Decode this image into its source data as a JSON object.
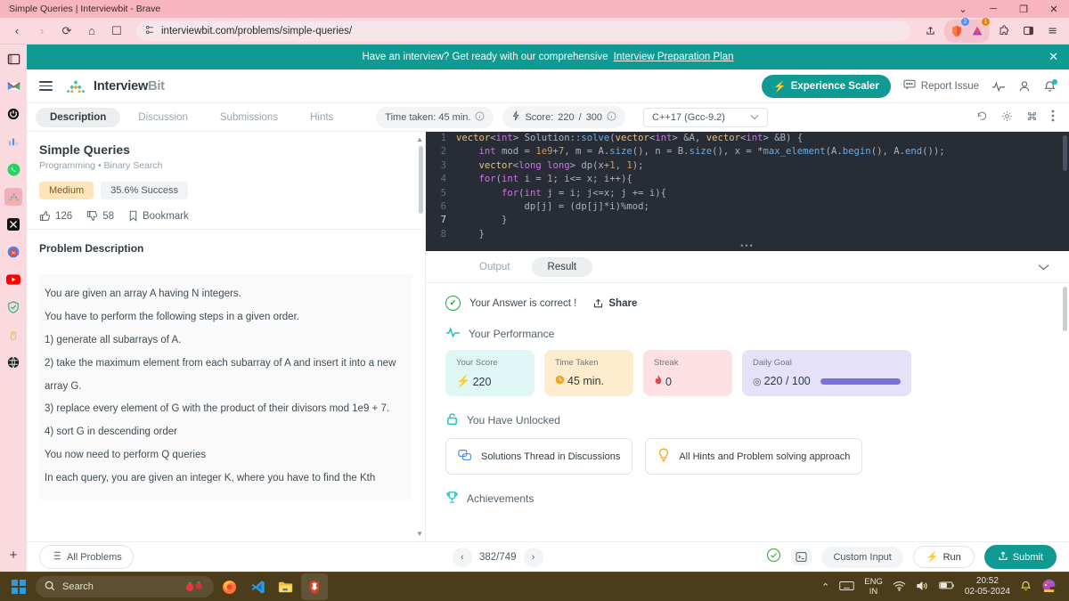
{
  "browser": {
    "tab_title": "Simple Queries | Interviewbit - Brave",
    "url": "interviewbit.com/problems/simple-queries/",
    "window_controls": {
      "minimize": "─",
      "maximize": "❐",
      "close": "✕",
      "tab_search": "⌄"
    },
    "nav": {
      "back": "‹",
      "forward": "›",
      "reload": "⟳",
      "home": "⌂",
      "bookmark": "☐"
    },
    "toolbar_icons": [
      "share-icon",
      "brave-shields-icon",
      "brave-rewards-icon",
      "extensions-icon",
      "sidebar-toggle-icon",
      "menu-icon"
    ],
    "shield_badge": "2",
    "rewards_badge": "1",
    "sidebar_items": [
      "sidebar-panel-icon",
      "gmail-icon",
      "power-icon",
      "chart-icon",
      "whatsapp-icon",
      "interviewbit-icon",
      "x-twitter-icon",
      "calendar-icon",
      "youtube-icon",
      "vpn-icon",
      "hands-icon",
      "globe-icon"
    ],
    "sidebar_add": "+"
  },
  "promo": {
    "text": "Have an interview? Get ready with our comprehensive",
    "link": "Interview Preparation Plan",
    "close": "✕"
  },
  "header": {
    "brand_first": "Interview",
    "brand_second": "Bit",
    "scaler_button": "Experience Scaler",
    "scaler_icon": "⚡",
    "report_issue": "Report Issue",
    "icons": [
      "activity-icon",
      "user-icon",
      "notification-bell-icon"
    ]
  },
  "subbar": {
    "tabs": [
      {
        "label": "Description",
        "active": true
      },
      {
        "label": "Discussion",
        "active": false
      },
      {
        "label": "Submissions",
        "active": false
      },
      {
        "label": "Hints",
        "active": false
      }
    ],
    "time_taken": "Time taken: 45 min.",
    "score": "Score:",
    "score_value": "220",
    "score_sep": "/",
    "score_total": "300",
    "language": "C++17 (Gcc-9.2)",
    "chevron": "⌄",
    "editor_tools": [
      "undo-icon",
      "settings-icon",
      "shortcuts-icon",
      "more-options-icon"
    ]
  },
  "problem": {
    "title": "Simple Queries",
    "subtitle": "Programming • Binary Search",
    "difficulty": "Medium",
    "success_rate": "35.6% Success",
    "likes": "126",
    "dislikes": "58",
    "bookmark": "Bookmark",
    "description_heading": "Problem Description",
    "paragraphs": [
      "You are given an array A having N integers.",
      "You have to perform the following steps in a given order.",
      "1) generate all subarrays of A.",
      "2) take the maximum element from each subarray of A and insert it into a new array G.",
      "3) replace every element of G with the product of their divisors mod 1e9 + 7.",
      "4) sort G in descending order",
      "You now need to perform Q queries",
      "In each query, you are given an integer K, where you have to find the Kth"
    ]
  },
  "editor": {
    "lines": [
      {
        "n": "1",
        "text": "vector<int> Solution::solve(vector<int> &A, vector<int> &B) {"
      },
      {
        "n": "2",
        "text": "    int mod = 1e9+7, m = A.size(), n = B.size(), x = *max_element(A.begin(), A.end());"
      },
      {
        "n": "3",
        "text": "    vector<long long> dp(x+1, 1);"
      },
      {
        "n": "4",
        "text": "    for(int i = 1; i<= x; i++){"
      },
      {
        "n": "5",
        "text": "        for(int j = i; j<=x; j += i){"
      },
      {
        "n": "6",
        "text": "            dp[j] = (dp[j]*i)%mod;"
      },
      {
        "n": "7",
        "text": "        }"
      },
      {
        "n": "8",
        "text": "    }"
      }
    ],
    "drag_handle": "•••"
  },
  "result": {
    "tabs": [
      {
        "label": "Output",
        "active": false
      },
      {
        "label": "Result",
        "active": true
      }
    ],
    "collapse_chevron": "⌄",
    "status_text": "Your Answer is correct !",
    "share": "Share",
    "performance_heading": "Your Performance",
    "cards": [
      {
        "label": "Your Score",
        "value": "220",
        "icon": "⚡",
        "bg": "#def7f5",
        "icon_color": "#1ec8bd"
      },
      {
        "label": "Time Taken",
        "value": "45 min.",
        "icon": "⏱",
        "bg": "#fdeccd",
        "icon_color": "#f0a32b"
      },
      {
        "label": "Streak",
        "value": "0",
        "icon": "●",
        "bg": "#fde0e1",
        "icon_color": "#e0474c"
      }
    ],
    "daily_goal": {
      "label": "Daily Goal",
      "value": "220 / 100",
      "icon": "◎",
      "bg": "#e4e1f8",
      "progress": 100
    },
    "unlocked_heading": "You Have Unlocked",
    "unlocked": [
      {
        "label": "Solutions Thread in Discussions",
        "icon": "discussion-icon"
      },
      {
        "label": "All Hints and Problem solving approach",
        "icon": "lightbulb-icon"
      }
    ],
    "achievements_heading": "Achievements"
  },
  "bottombar": {
    "all_problems": "All Problems",
    "prev": "‹",
    "next": "›",
    "counter": "382/749",
    "custom_input": "Custom Input",
    "run": "Run",
    "run_icon": "⚡",
    "submit": "Submit",
    "submit_icon": "⤒",
    "icons": [
      "check-circle-icon",
      "console-icon"
    ]
  },
  "taskbar": {
    "search_placeholder": "Search",
    "apps": [
      "strawberry-icon",
      "firefox-icon",
      "vscode-icon",
      "file-explorer-icon",
      "brave-icon"
    ],
    "tray": {
      "chevron": "⌃",
      "keyboard": "keyboard-icon",
      "language_top": "ENG",
      "language_bottom": "IN",
      "wifi": "wifi-icon",
      "volume": "volume-icon",
      "battery": "battery-icon",
      "time": "20:52",
      "date": "02-05-2024",
      "bell": "notification-icon",
      "widget": "paint-icon"
    }
  },
  "colors": {
    "brand_teal": "#0f9b93",
    "chrome_pink": "#fadadf",
    "taskbar": "#4b3c1b",
    "editor_bg": "#282c34",
    "accent_purple": "#7b6fdc"
  }
}
